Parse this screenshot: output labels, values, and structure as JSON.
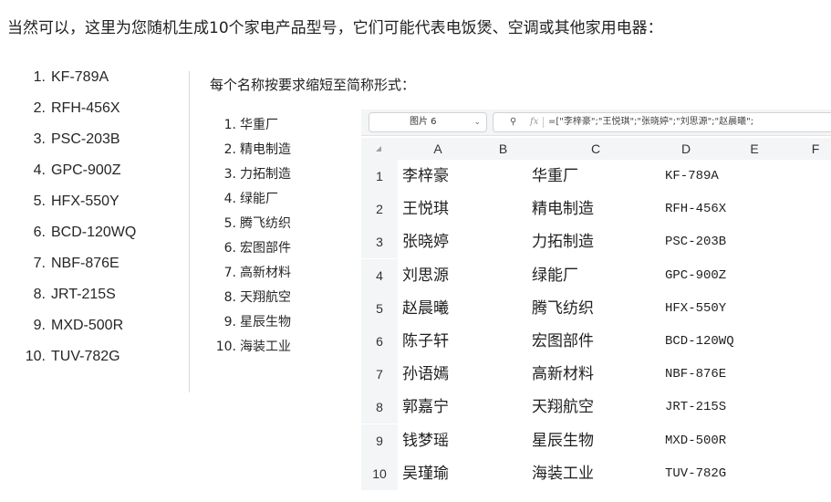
{
  "intro_text": "当然可以，这里为您随机生成10个家电产品型号，它们可能代表电饭煲、空调或其他家用电器：",
  "models": [
    {
      "num": "1.",
      "code": "KF-789A"
    },
    {
      "num": "2.",
      "code": "RFH-456X"
    },
    {
      "num": "3.",
      "code": "PSC-203B"
    },
    {
      "num": "4.",
      "code": "GPC-900Z"
    },
    {
      "num": "5.",
      "code": "HFX-550Y"
    },
    {
      "num": "6.",
      "code": "BCD-120WQ"
    },
    {
      "num": "7.",
      "code": "NBF-876E"
    },
    {
      "num": "8.",
      "code": "JRT-215S"
    },
    {
      "num": "9.",
      "code": "MXD-500R"
    },
    {
      "num": "10.",
      "code": "TUV-782G"
    }
  ],
  "short_title": "每个名称按要求缩短至简称形式：",
  "short_names": [
    {
      "num": "1.",
      "name": "华重厂"
    },
    {
      "num": "2.",
      "name": "精电制造"
    },
    {
      "num": "3.",
      "name": "力拓制造"
    },
    {
      "num": "4.",
      "name": "绿能厂"
    },
    {
      "num": "5.",
      "name": "腾飞纺织"
    },
    {
      "num": "6.",
      "name": "宏图部件"
    },
    {
      "num": "7.",
      "name": "高新材料"
    },
    {
      "num": "8.",
      "name": "天翔航空"
    },
    {
      "num": "9.",
      "name": "星辰生物"
    },
    {
      "num": "10.",
      "name": "海装工业"
    }
  ],
  "spreadsheet": {
    "name_box": "图片 6",
    "fx_label": "fx",
    "formula": "=[\"李梓豪\";\"王悦琪\";\"张晓婷\";\"刘思源\";\"赵晨曦\";",
    "columns": [
      "A",
      "B",
      "C",
      "D",
      "E",
      "F"
    ],
    "rows": [
      {
        "n": "1",
        "a": "李梓豪",
        "c": "华重厂",
        "e": "KF-789A"
      },
      {
        "n": "2",
        "a": "王悦琪",
        "c": "精电制造",
        "e": "RFH-456X"
      },
      {
        "n": "3",
        "a": "张晓婷",
        "c": "力拓制造",
        "e": "PSC-203B"
      },
      {
        "n": "4",
        "a": "刘思源",
        "c": "绿能厂",
        "e": "GPC-900Z"
      },
      {
        "n": "5",
        "a": "赵晨曦",
        "c": "腾飞纺织",
        "e": "HFX-550Y"
      },
      {
        "n": "6",
        "a": "陈子轩",
        "c": "宏图部件",
        "e": "BCD-120WQ"
      },
      {
        "n": "7",
        "a": "孙语嫣",
        "c": "高新材料",
        "e": "NBF-876E"
      },
      {
        "n": "8",
        "a": "郭嘉宁",
        "c": "天翔航空",
        "e": "JRT-215S"
      },
      {
        "n": "9",
        "a": "钱梦瑶",
        "c": "星辰生物",
        "e": "MXD-500R"
      },
      {
        "n": "10",
        "a": "吴瑾瑜",
        "c": "海装工业",
        "e": "TUV-782G"
      }
    ]
  }
}
